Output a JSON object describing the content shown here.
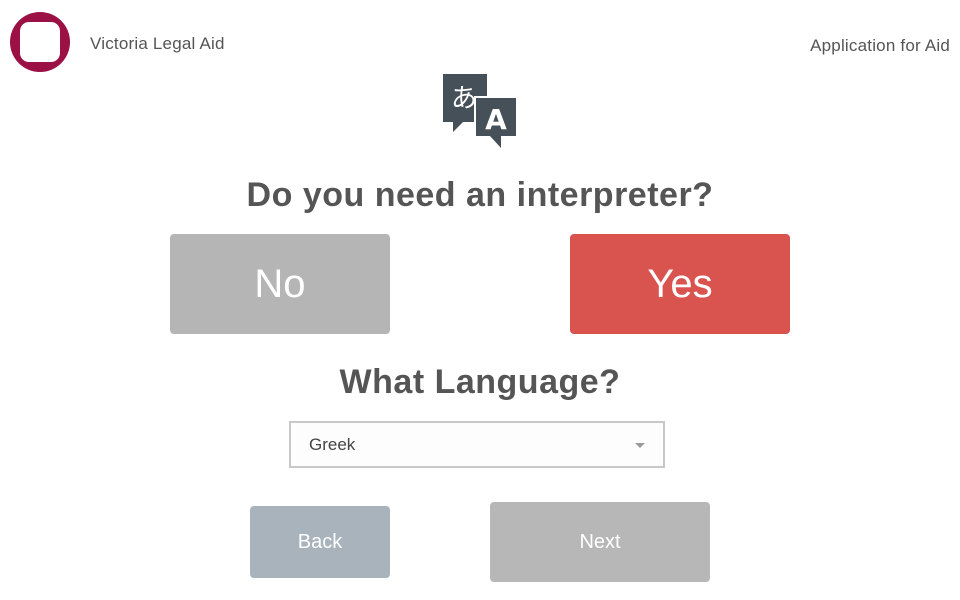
{
  "header": {
    "organization": "Victoria Legal Aid",
    "app_title": "Application for Aid",
    "logo_color": "#9b1045"
  },
  "icon": {
    "name": "translate-icon",
    "glyph_left": "あ",
    "glyph_right": "A"
  },
  "question": {
    "interpreter_label": "Do you need an interpreter?",
    "no_label": "No",
    "yes_label": "Yes",
    "selected": "Yes",
    "no_color": "#b5b5b5",
    "yes_color": "#d9534f"
  },
  "language": {
    "label": "What Language?",
    "selected_value": "Greek"
  },
  "navigation": {
    "back_label": "Back",
    "next_label": "Next",
    "back_color": "#a9b3bb",
    "next_color": "#b7b7b7"
  }
}
